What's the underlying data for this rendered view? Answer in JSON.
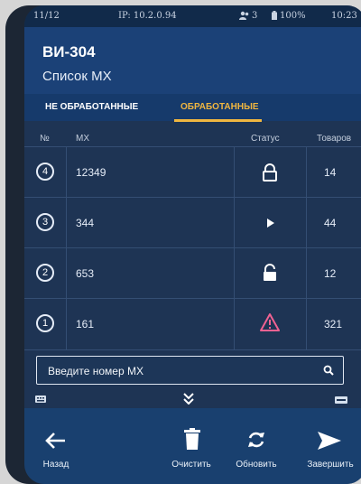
{
  "status_bar": {
    "left_text": "11/12",
    "ip": "IP: 10.2.0.94",
    "users_count": "3",
    "battery": "100%",
    "time": "10:23"
  },
  "header": {
    "title": "ВИ-304",
    "subtitle": "Список МХ"
  },
  "tabs": [
    {
      "label": "НЕ ОБРАБОТАННЫЕ"
    },
    {
      "label": "ОБРАБОТАННЫЕ"
    }
  ],
  "table": {
    "headers": {
      "num": "№",
      "mx": "МХ",
      "status": "Статус",
      "items": "Товаров"
    },
    "rows": [
      {
        "num": "4",
        "mx": "12349",
        "status": "lock-closed",
        "count": "14"
      },
      {
        "num": "3",
        "mx": "344",
        "status": "play",
        "count": "44"
      },
      {
        "num": "2",
        "mx": "653",
        "status": "lock-open",
        "count": "12"
      },
      {
        "num": "1",
        "mx": "161",
        "status": "warning",
        "count": "321"
      }
    ]
  },
  "search": {
    "placeholder": "Введите номер МХ"
  },
  "footer": {
    "back": "Назад",
    "clear": "Очистить",
    "refresh": "Обновить",
    "finish": "Завершить"
  },
  "colors": {
    "accent_tab": "#f0b640",
    "warning_icon": "#f06292",
    "screen_bg": "#1e3454"
  }
}
